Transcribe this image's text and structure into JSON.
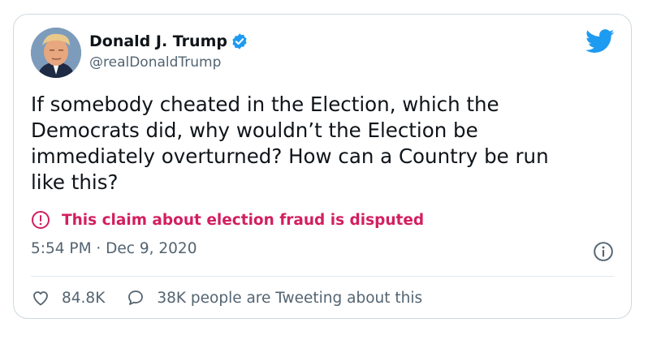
{
  "author": {
    "name": "Donald J. Trump",
    "handle": "@realDonaldTrump",
    "verified": true
  },
  "tweet": {
    "text": "If somebody cheated in the Election, which the\nDemocrats did, why wouldn’t the Election be\nimmediately overturned? How can a Country be run\nlike this?"
  },
  "notice": {
    "icon": "exclamation-circle-icon",
    "text": "This claim about election fraud is disputed",
    "color": "#d21f5f"
  },
  "meta": {
    "timestamp": "5:54 PM · Dec 9, 2020"
  },
  "actions": {
    "likes": "84.8K",
    "conversation": "38K people are Tweeting about this"
  },
  "colors": {
    "brand": "#1d9bf0",
    "secondary_text": "#536471",
    "border": "#cfd9de"
  }
}
